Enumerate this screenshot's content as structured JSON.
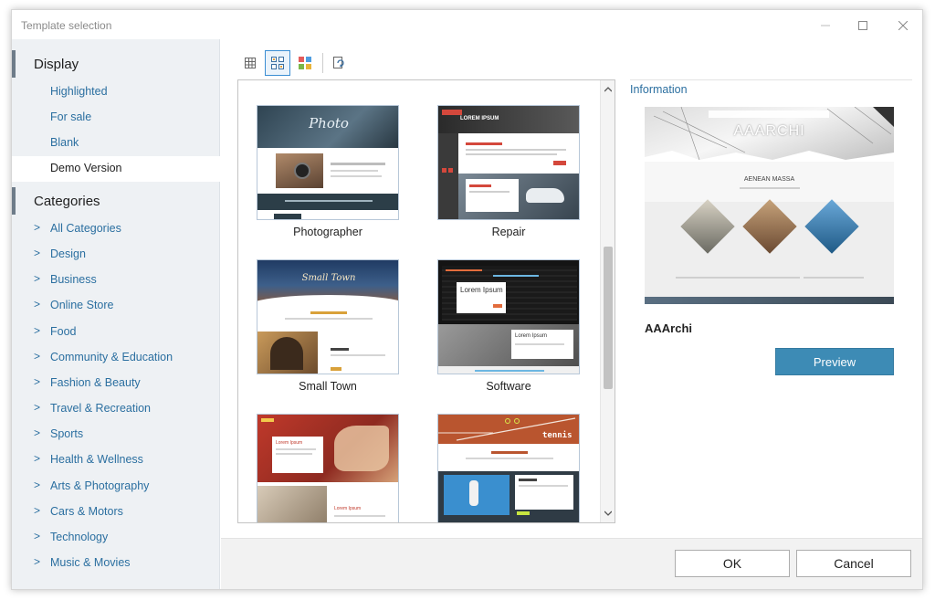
{
  "window": {
    "title": "Template selection"
  },
  "sidebar": {
    "display_header": "Display",
    "display_items": [
      {
        "label": "Highlighted"
      },
      {
        "label": "For sale"
      },
      {
        "label": "Blank"
      },
      {
        "label": "Demo Version",
        "selected": true
      }
    ],
    "categories_header": "Categories",
    "category_items": [
      {
        "label": "All Categories"
      },
      {
        "label": "Design"
      },
      {
        "label": "Business"
      },
      {
        "label": "Online Store"
      },
      {
        "label": "Food"
      },
      {
        "label": "Community & Education"
      },
      {
        "label": "Fashion & Beauty"
      },
      {
        "label": "Travel & Recreation"
      },
      {
        "label": "Sports"
      },
      {
        "label": "Health & Wellness"
      },
      {
        "label": "Arts & Photography"
      },
      {
        "label": "Cars & Motors"
      },
      {
        "label": "Technology"
      },
      {
        "label": "Music & Movies"
      }
    ],
    "chevron": ">"
  },
  "toolbar": {
    "buttons": [
      {
        "icon": "small-grid-icon"
      },
      {
        "icon": "large-grid-icon",
        "active": true
      },
      {
        "icon": "color-grid-icon"
      },
      {
        "icon": "refresh-icon"
      }
    ]
  },
  "gallery": {
    "templates": [
      {
        "caption": "Photographer",
        "thumb_text": "Photo"
      },
      {
        "caption": "Repair",
        "thumb_text": "LOREM IPSUM"
      },
      {
        "caption": "Small Town",
        "thumb_text": "Small Town"
      },
      {
        "caption": "Software",
        "thumb_text": "Lorem Ipsum"
      },
      {
        "caption": "",
        "thumb_text": "Lorem Ipsum"
      },
      {
        "caption": "",
        "thumb_text": "tennis"
      }
    ]
  },
  "info": {
    "title": "Information",
    "preview_heading": "AAARCHI",
    "preview_subheading": "AENEAN MASSA",
    "template_name": "AAArchi",
    "preview_button": "Preview"
  },
  "footer": {
    "ok_label": "OK",
    "cancel_label": "Cancel"
  },
  "colors": {
    "accent": "#3d8bb5",
    "link": "#2b6fa0",
    "sidebar_bg": "#eef1f4"
  }
}
